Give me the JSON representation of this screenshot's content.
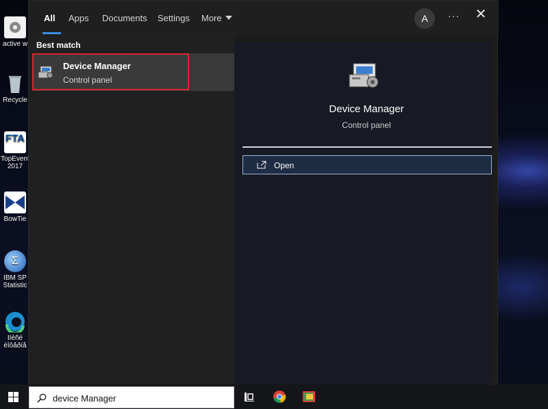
{
  "desktop": {
    "icons": [
      {
        "label": "active w",
        "icon": "gear-icon"
      },
      {
        "label": "Recycle",
        "icon": "recycle-bin-icon"
      },
      {
        "label": "TopEvent 2017",
        "label_line1": "TopEvent",
        "label_line2": "2017",
        "icon": "ftA-icon",
        "badge": "FTA"
      },
      {
        "label": "BowTie",
        "icon": "bowtie-icon"
      },
      {
        "label": "IBM SP Statistic",
        "label_line1": "IBM SP",
        "label_line2": "Statistic",
        "icon": "spss-icon"
      },
      {
        "label": "ÌÍèñé èîôåðíå",
        "label_line1": "ÌÍèñé",
        "label_line2": "èîôåðíå",
        "icon": "edge-icon"
      }
    ]
  },
  "tabs": [
    {
      "label": "All",
      "active": true
    },
    {
      "label": "Apps",
      "active": false
    },
    {
      "label": "Documents",
      "active": false
    },
    {
      "label": "Settings",
      "active": false
    },
    {
      "label": "More",
      "active": false
    }
  ],
  "header": {
    "avatar_letter": "A",
    "more_options": "···",
    "close": "✕"
  },
  "results": {
    "section_title": "Best match",
    "best_match": {
      "title": "Device Manager",
      "subtitle": "Control panel"
    }
  },
  "detail": {
    "title": "Device Manager",
    "subtitle": "Control panel",
    "actions": [
      {
        "label": "Open",
        "icon": "open-icon"
      }
    ]
  },
  "taskbar": {
    "search_value": "device Manager",
    "icons": [
      "task-view-icon",
      "chrome-icon",
      "photos-icon"
    ]
  },
  "colors": {
    "accent": "#3b8fe6",
    "highlight_border": "#d9262e",
    "menu_bg": "#1c1c1c"
  }
}
